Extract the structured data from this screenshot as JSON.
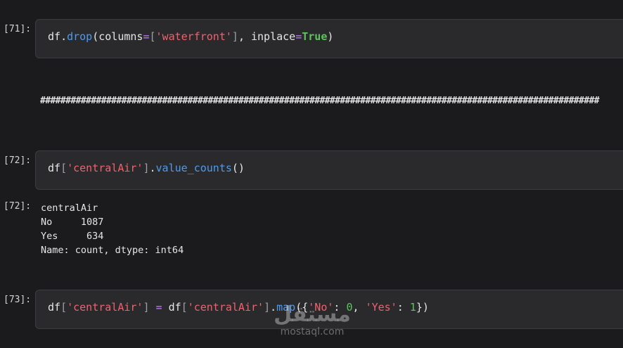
{
  "cells": [
    {
      "prompt": "[71]:",
      "tokens": [
        "df",
        ".",
        "drop",
        "(columns",
        "=",
        "[",
        "'waterfront'",
        "]",
        ", inplace",
        "=",
        "True",
        ")"
      ]
    },
    {
      "prompt": "[72]:",
      "tokens": [
        "df",
        "[",
        "'centralAir'",
        "]",
        ".",
        "value_counts",
        "()"
      ]
    },
    {
      "prompt": "[73]:",
      "tokens": [
        "df",
        "[",
        "'centralAir'",
        "]",
        " = ",
        "df",
        "[",
        "'centralAir'",
        "]",
        ".",
        "map",
        "({",
        "'No'",
        ": ",
        "0",
        ", ",
        "'Yes'",
        ": ",
        "1",
        "})"
      ]
    }
  ],
  "separator": "##############################################################################################################",
  "output_72": {
    "prompt": "[72]:",
    "text": "centralAir\nNo     1087\nYes     634\nName: count, dtype: int64"
  },
  "watermark": {
    "logo": "مستقل",
    "text": "mostaql.com"
  }
}
